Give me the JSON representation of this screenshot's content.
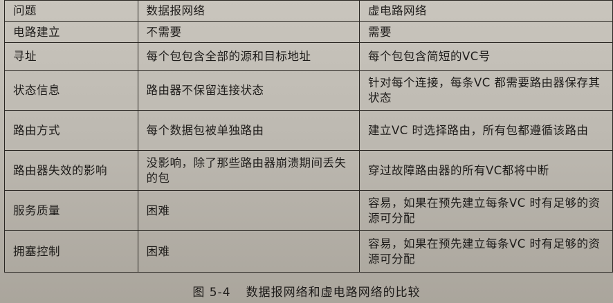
{
  "headers": [
    "问题",
    "数据报网络",
    "虚电路网络"
  ],
  "rows": [
    [
      "电路建立",
      "不需要",
      "需要"
    ],
    [
      "寻址",
      "每个包包含全部的源和目标地址",
      "每个包包含简短的VC号"
    ],
    [
      "状态信息",
      "路由器不保留连接状态",
      "针对每个连接，每条VC 都需要路由器保存其状态"
    ],
    [
      "路由方式",
      "每个数据包被单独路由",
      "建立VC 时选择路由，所有包都遵循该路由"
    ],
    [
      "路由器失效的影响",
      "没影响，除了那些路由器崩溃期间丢失的包",
      "穿过故障路由器的所有VC都将中断"
    ],
    [
      "服务质量",
      "困难",
      "容易，如果在预先建立每条VC 时有足够的资源可分配"
    ],
    [
      "拥塞控制",
      "困难",
      "容易，如果在预先建立每条VC 时有足够的资源可分配"
    ]
  ],
  "caption": {
    "number": "图 5-4",
    "title": "数据报网络和虚电路网络的比较"
  }
}
